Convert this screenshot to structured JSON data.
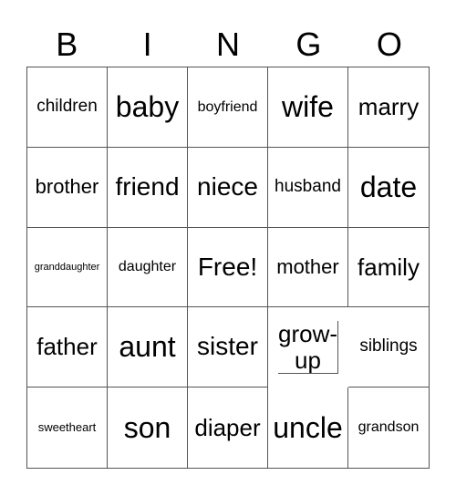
{
  "header": [
    "B",
    "I",
    "N",
    "G",
    "O"
  ],
  "cells": [
    "children",
    "baby",
    "boyfriend",
    "wife",
    "marry",
    "brother",
    "friend",
    "niece",
    "husband",
    "date",
    "granddaughter",
    "daughter",
    "Free!",
    "mother",
    "family",
    "father",
    "aunt",
    "sister",
    "grow-up",
    "siblings",
    "sweetheart",
    "son",
    "diaper",
    "uncle",
    "grandson"
  ]
}
